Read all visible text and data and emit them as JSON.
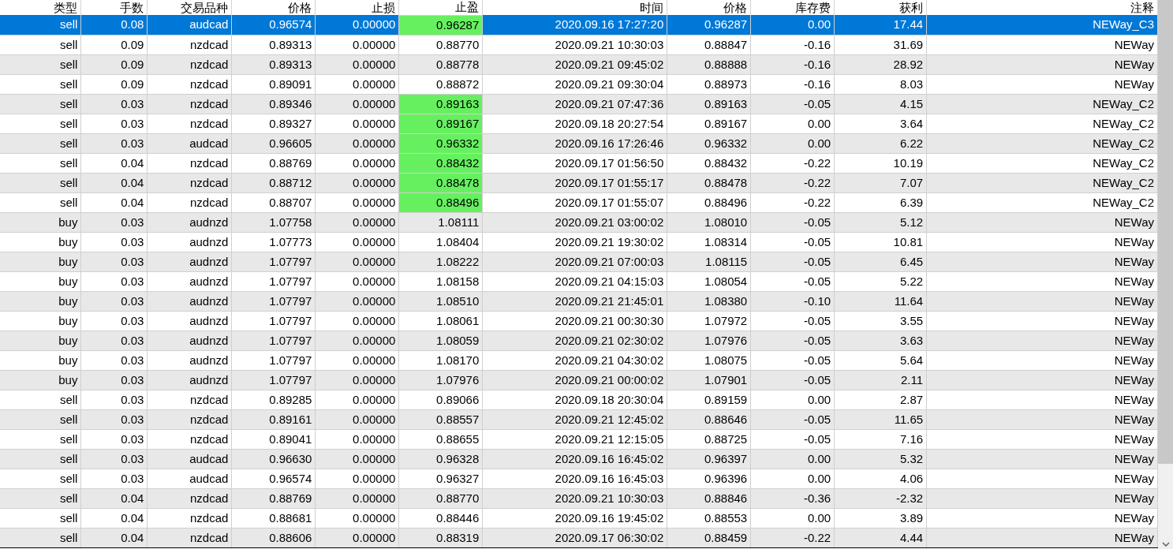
{
  "table": {
    "columns": [
      "类型",
      "手数",
      "交易品种",
      "价格",
      "止损",
      "止盈",
      "时间",
      "价格",
      "库存费",
      "获利",
      "注释"
    ],
    "rows": [
      {
        "cells": [
          "sell",
          "0.08",
          "audcad",
          "0.96574",
          "0.00000",
          "0.96287",
          "2020.09.16 17:27:20",
          "0.96287",
          "0.00",
          "17.44",
          "NEWay_C3"
        ],
        "selected": true,
        "tp_highlighted": true
      },
      {
        "cells": [
          "sell",
          "0.09",
          "nzdcad",
          "0.89313",
          "0.00000",
          "0.88770",
          "2020.09.21 10:30:03",
          "0.88847",
          "-0.16",
          "31.69",
          "NEWay"
        ],
        "selected": false,
        "tp_highlighted": false
      },
      {
        "cells": [
          "sell",
          "0.09",
          "nzdcad",
          "0.89313",
          "0.00000",
          "0.88778",
          "2020.09.21 09:45:02",
          "0.88888",
          "-0.16",
          "28.92",
          "NEWay"
        ],
        "selected": false,
        "tp_highlighted": false
      },
      {
        "cells": [
          "sell",
          "0.09",
          "nzdcad",
          "0.89091",
          "0.00000",
          "0.88872",
          "2020.09.21 09:30:04",
          "0.88973",
          "-0.16",
          "8.03",
          "NEWay"
        ],
        "selected": false,
        "tp_highlighted": false
      },
      {
        "cells": [
          "sell",
          "0.03",
          "nzdcad",
          "0.89346",
          "0.00000",
          "0.89163",
          "2020.09.21 07:47:36",
          "0.89163",
          "-0.05",
          "4.15",
          "NEWay_C2"
        ],
        "selected": false,
        "tp_highlighted": true
      },
      {
        "cells": [
          "sell",
          "0.03",
          "nzdcad",
          "0.89327",
          "0.00000",
          "0.89167",
          "2020.09.18 20:27:54",
          "0.89167",
          "0.00",
          "3.64",
          "NEWay_C2"
        ],
        "selected": false,
        "tp_highlighted": true
      },
      {
        "cells": [
          "sell",
          "0.03",
          "audcad",
          "0.96605",
          "0.00000",
          "0.96332",
          "2020.09.16 17:26:46",
          "0.96332",
          "0.00",
          "6.22",
          "NEWay_C2"
        ],
        "selected": false,
        "tp_highlighted": true
      },
      {
        "cells": [
          "sell",
          "0.04",
          "nzdcad",
          "0.88769",
          "0.00000",
          "0.88432",
          "2020.09.17 01:56:50",
          "0.88432",
          "-0.22",
          "10.19",
          "NEWay_C2"
        ],
        "selected": false,
        "tp_highlighted": true
      },
      {
        "cells": [
          "sell",
          "0.04",
          "nzdcad",
          "0.88712",
          "0.00000",
          "0.88478",
          "2020.09.17 01:55:17",
          "0.88478",
          "-0.22",
          "7.07",
          "NEWay_C2"
        ],
        "selected": false,
        "tp_highlighted": true
      },
      {
        "cells": [
          "sell",
          "0.04",
          "nzdcad",
          "0.88707",
          "0.00000",
          "0.88496",
          "2020.09.17 01:55:07",
          "0.88496",
          "-0.22",
          "6.39",
          "NEWay_C2"
        ],
        "selected": false,
        "tp_highlighted": true
      },
      {
        "cells": [
          "buy",
          "0.03",
          "audnzd",
          "1.07758",
          "0.00000",
          "1.08111",
          "2020.09.21 03:00:02",
          "1.08010",
          "-0.05",
          "5.12",
          "NEWay"
        ],
        "selected": false,
        "tp_highlighted": false
      },
      {
        "cells": [
          "buy",
          "0.03",
          "audnzd",
          "1.07773",
          "0.00000",
          "1.08404",
          "2020.09.21 19:30:02",
          "1.08314",
          "-0.05",
          "10.81",
          "NEWay"
        ],
        "selected": false,
        "tp_highlighted": false
      },
      {
        "cells": [
          "buy",
          "0.03",
          "audnzd",
          "1.07797",
          "0.00000",
          "1.08222",
          "2020.09.21 07:00:03",
          "1.08115",
          "-0.05",
          "6.45",
          "NEWay"
        ],
        "selected": false,
        "tp_highlighted": false
      },
      {
        "cells": [
          "buy",
          "0.03",
          "audnzd",
          "1.07797",
          "0.00000",
          "1.08158",
          "2020.09.21 04:15:03",
          "1.08054",
          "-0.05",
          "5.22",
          "NEWay"
        ],
        "selected": false,
        "tp_highlighted": false
      },
      {
        "cells": [
          "buy",
          "0.03",
          "audnzd",
          "1.07797",
          "0.00000",
          "1.08510",
          "2020.09.21 21:45:01",
          "1.08380",
          "-0.10",
          "11.64",
          "NEWay"
        ],
        "selected": false,
        "tp_highlighted": false
      },
      {
        "cells": [
          "buy",
          "0.03",
          "audnzd",
          "1.07797",
          "0.00000",
          "1.08061",
          "2020.09.21 00:30:30",
          "1.07972",
          "-0.05",
          "3.55",
          "NEWay"
        ],
        "selected": false,
        "tp_highlighted": false
      },
      {
        "cells": [
          "buy",
          "0.03",
          "audnzd",
          "1.07797",
          "0.00000",
          "1.08059",
          "2020.09.21 02:30:02",
          "1.07976",
          "-0.05",
          "3.63",
          "NEWay"
        ],
        "selected": false,
        "tp_highlighted": false
      },
      {
        "cells": [
          "buy",
          "0.03",
          "audnzd",
          "1.07797",
          "0.00000",
          "1.08170",
          "2020.09.21 04:30:02",
          "1.08075",
          "-0.05",
          "5.64",
          "NEWay"
        ],
        "selected": false,
        "tp_highlighted": false
      },
      {
        "cells": [
          "buy",
          "0.03",
          "audnzd",
          "1.07797",
          "0.00000",
          "1.07976",
          "2020.09.21 00:00:02",
          "1.07901",
          "-0.05",
          "2.11",
          "NEWay"
        ],
        "selected": false,
        "tp_highlighted": false
      },
      {
        "cells": [
          "sell",
          "0.03",
          "nzdcad",
          "0.89285",
          "0.00000",
          "0.89066",
          "2020.09.18 20:30:04",
          "0.89159",
          "0.00",
          "2.87",
          "NEWay"
        ],
        "selected": false,
        "tp_highlighted": false
      },
      {
        "cells": [
          "sell",
          "0.03",
          "nzdcad",
          "0.89161",
          "0.00000",
          "0.88557",
          "2020.09.21 12:45:02",
          "0.88646",
          "-0.05",
          "11.65",
          "NEWay"
        ],
        "selected": false,
        "tp_highlighted": false
      },
      {
        "cells": [
          "sell",
          "0.03",
          "nzdcad",
          "0.89041",
          "0.00000",
          "0.88655",
          "2020.09.21 12:15:05",
          "0.88725",
          "-0.05",
          "7.16",
          "NEWay"
        ],
        "selected": false,
        "tp_highlighted": false
      },
      {
        "cells": [
          "sell",
          "0.03",
          "audcad",
          "0.96630",
          "0.00000",
          "0.96328",
          "2020.09.16 16:45:02",
          "0.96397",
          "0.00",
          "5.32",
          "NEWay"
        ],
        "selected": false,
        "tp_highlighted": false
      },
      {
        "cells": [
          "sell",
          "0.03",
          "audcad",
          "0.96574",
          "0.00000",
          "0.96327",
          "2020.09.16 16:45:03",
          "0.96396",
          "0.00",
          "4.06",
          "NEWay"
        ],
        "selected": false,
        "tp_highlighted": false
      },
      {
        "cells": [
          "sell",
          "0.04",
          "nzdcad",
          "0.88769",
          "0.00000",
          "0.88770",
          "2020.09.21 10:30:03",
          "0.88846",
          "-0.36",
          "-2.32",
          "NEWay"
        ],
        "selected": false,
        "tp_highlighted": false
      },
      {
        "cells": [
          "sell",
          "0.04",
          "nzdcad",
          "0.88681",
          "0.00000",
          "0.88446",
          "2020.09.16 19:45:02",
          "0.88553",
          "0.00",
          "3.89",
          "NEWay"
        ],
        "selected": false,
        "tp_highlighted": false
      },
      {
        "cells": [
          "sell",
          "0.04",
          "nzdcad",
          "0.88606",
          "0.00000",
          "0.88319",
          "2020.09.17 06:30:02",
          "0.88459",
          "-0.22",
          "4.44",
          "NEWay"
        ],
        "selected": false,
        "tp_highlighted": false
      }
    ]
  }
}
